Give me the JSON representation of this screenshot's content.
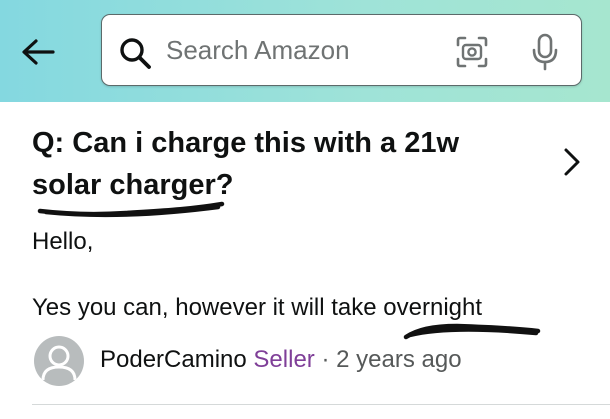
{
  "header": {
    "search_placeholder": "Search Amazon",
    "back_icon": "arrow-left-icon",
    "search_icon": "magnifier-icon",
    "camera_icon": "camera-scan-icon",
    "mic_icon": "microphone-icon"
  },
  "qa": {
    "question_prefix": "Q:",
    "question_line1": "Can i charge this with a 21w",
    "question_line2": "solar charger?",
    "answer_greeting": "Hello,",
    "answer_body": "Yes you can, however it will take overnight",
    "author": "PoderCamino",
    "author_role": "Seller",
    "separator": "·",
    "time_ago": "2 years ago"
  },
  "colors": {
    "header_gradient_start": "#84d8e0",
    "header_gradient_end": "#a6e6cf",
    "seller_purple": "#7f3f98",
    "annotation_ink": "#111111"
  }
}
